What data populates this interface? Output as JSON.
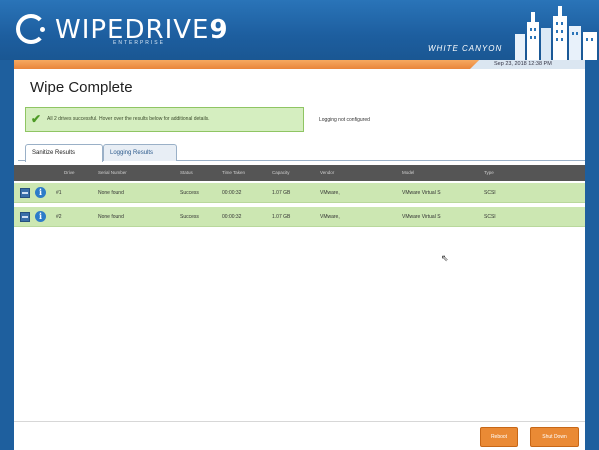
{
  "header": {
    "logo_text": "WIPEDRIVE",
    "logo_number": "9",
    "logo_edition": "ENTERPRISE",
    "brand": "WHITE CANYON",
    "datetime": "Sep 23, 2018 12:38 PM"
  },
  "page": {
    "title": "Wipe Complete",
    "success_message": "All 2 drives successful. Hover over the results below for additional details.",
    "logging_status": "Logging not configured"
  },
  "tabs": [
    {
      "label": "Sanitize Results"
    },
    {
      "label": "Logging Results"
    }
  ],
  "table": {
    "columns": [
      "Drive",
      "Serial Number",
      "Status",
      "Time Taken",
      "Capacity",
      "Vendor",
      "Model",
      "Type"
    ],
    "rows": [
      {
        "drive": "#1",
        "serial": "None found",
        "status": "Success",
        "time": "00:00:32",
        "capacity": "1.07 GB",
        "vendor": "VMware,",
        "model": "VMware Virtual S",
        "type": "SCSI"
      },
      {
        "drive": "#2",
        "serial": "None found",
        "status": "Success",
        "time": "00:00:32",
        "capacity": "1.07 GB",
        "vendor": "VMware,",
        "model": "VMware Virtual S",
        "type": "SCSI"
      }
    ]
  },
  "footer": {
    "reboot_label": "Reboot",
    "shutdown_label": "Shut Down"
  },
  "colors": {
    "header_blue": "#1d5e9f",
    "accent_orange": "#e9853b",
    "success_green": "#cce7b2",
    "table_header": "#555555"
  },
  "icons": [
    "check-icon",
    "drive-icon",
    "info-icon",
    "cursor-icon",
    "skyline-logo"
  ]
}
